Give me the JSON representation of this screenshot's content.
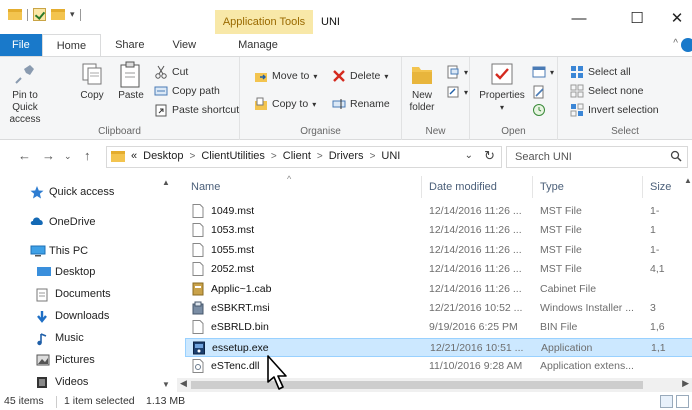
{
  "window": {
    "title": "UNI",
    "context_tab": "Application Tools",
    "minimize": "—",
    "maximize": "☐",
    "close": "✕"
  },
  "tabs": {
    "file": "File",
    "home": "Home",
    "share": "Share",
    "view": "View",
    "manage": "Manage"
  },
  "ribbon": {
    "clipboard": {
      "label": "Clipboard",
      "pin_line1": "Pin to Quick",
      "pin_line2": "access",
      "copy": "Copy",
      "paste": "Paste",
      "cut": "Cut",
      "copy_path": "Copy path",
      "paste_shortcut": "Paste shortcut"
    },
    "organise": {
      "label": "Organise",
      "move_to": "Move to",
      "copy_to": "Copy to",
      "delete": "Delete",
      "rename": "Rename"
    },
    "new": {
      "label": "New",
      "new_folder_line1": "New",
      "new_folder_line2": "folder"
    },
    "open": {
      "label": "Open",
      "properties": "Properties"
    },
    "select": {
      "label": "Select",
      "select_all": "Select all",
      "select_none": "Select none",
      "invert": "Invert selection"
    }
  },
  "address": {
    "overflow": "«",
    "crumbs": [
      "Desktop",
      "ClientUtilities",
      "Client",
      "Drivers",
      "UNI"
    ],
    "search_placeholder": "Search UNI"
  },
  "navpane": {
    "quick_access": "Quick access",
    "onedrive": "OneDrive",
    "this_pc": "This PC",
    "desktop": "Desktop",
    "documents": "Documents",
    "downloads": "Downloads",
    "music": "Music",
    "pictures": "Pictures",
    "videos": "Videos"
  },
  "columns": {
    "name": "Name",
    "date": "Date modified",
    "type": "Type",
    "size": "Size"
  },
  "files": [
    {
      "name": "1049.mst",
      "date": "12/14/2016 11:26 ...",
      "type": "MST File",
      "size": "1-",
      "icon": "file-icon"
    },
    {
      "name": "1053.mst",
      "date": "12/14/2016 11:26 ...",
      "type": "MST File",
      "size": "1",
      "icon": "file-icon"
    },
    {
      "name": "1055.mst",
      "date": "12/14/2016 11:26 ...",
      "type": "MST File",
      "size": "1-",
      "icon": "file-icon"
    },
    {
      "name": "2052.mst",
      "date": "12/14/2016 11:26 ...",
      "type": "MST File",
      "size": "4,1",
      "icon": "file-icon"
    },
    {
      "name": "Applic~1.cab",
      "date": "12/14/2016 11:26 ...",
      "type": "Cabinet File",
      "size": "",
      "icon": "cabinet-icon"
    },
    {
      "name": "eSBKRT.msi",
      "date": "12/21/2016 10:52 ...",
      "type": "Windows Installer ...",
      "size": "3",
      "icon": "installer-icon"
    },
    {
      "name": "eSBRLD.bin",
      "date": "9/19/2016 6:25 PM",
      "type": "BIN File",
      "size": "1,6",
      "icon": "file-icon"
    },
    {
      "name": "essetup.exe",
      "date": "12/21/2016 10:51 ...",
      "type": "Application",
      "size": "1,1",
      "icon": "application-icon",
      "selected": true
    },
    {
      "name": "eSTenc.dll",
      "date": "11/10/2016 9:28 AM",
      "type": "Application extens...",
      "size": "",
      "icon": "dll-icon"
    }
  ],
  "status": {
    "items": "45 items",
    "selected": "1 item selected",
    "size": "1.13 MB"
  }
}
